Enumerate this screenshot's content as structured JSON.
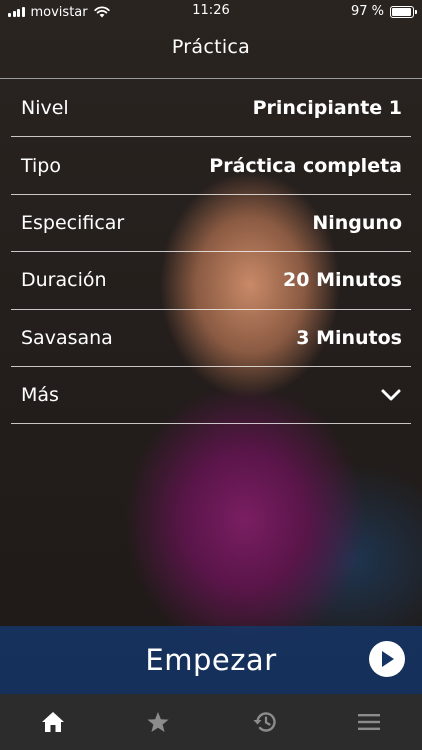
{
  "status_bar": {
    "carrier": "movistar",
    "time": "11:26",
    "battery_text": "97 %",
    "battery_level": 0.97
  },
  "nav": {
    "title": "Práctica"
  },
  "settings": [
    {
      "label": "Nivel",
      "value": "Principiante 1"
    },
    {
      "label": "Tipo",
      "value": "Práctica completa"
    },
    {
      "label": "Especificar",
      "value": "Ninguno"
    },
    {
      "label": "Duración",
      "value": "20 Minutos"
    },
    {
      "label": "Savasana",
      "value": "3 Minutos"
    },
    {
      "label": "Más",
      "icon": "chevron-down-icon"
    }
  ],
  "start": {
    "label": "Empezar",
    "icon": "play-icon"
  },
  "tabs": [
    {
      "name": "home",
      "icon": "home-icon",
      "active": true
    },
    {
      "name": "favorites",
      "icon": "star-icon",
      "active": false
    },
    {
      "name": "history",
      "icon": "history-icon",
      "active": false
    },
    {
      "name": "menu",
      "icon": "menu-icon",
      "active": false
    }
  ],
  "colors": {
    "start_bar": "#143464",
    "tab_bar": "#2c2c2c",
    "tab_active": "#ffffff",
    "tab_inactive": "#8c8c8c"
  }
}
